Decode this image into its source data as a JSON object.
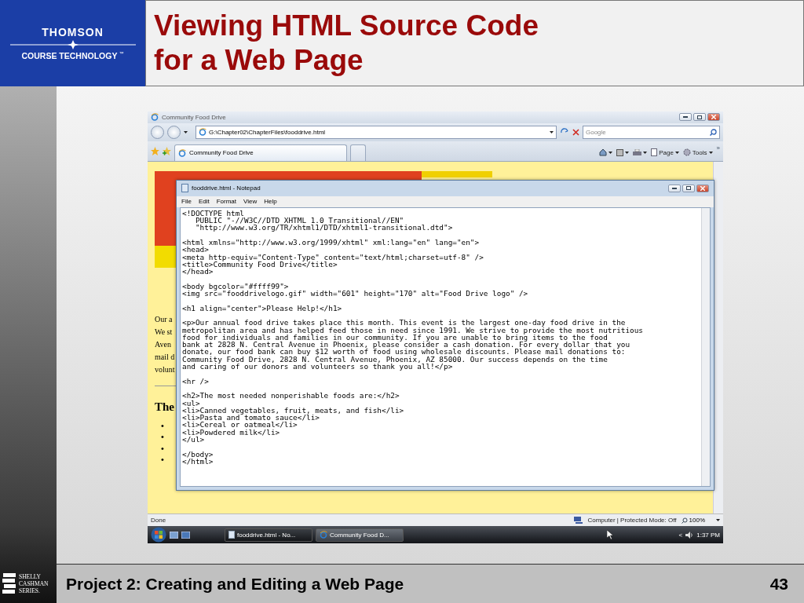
{
  "slide": {
    "logo": {
      "brand": "THOMSON",
      "sub": "COURSE TECHNOLOGY",
      "tm": "™"
    },
    "title_lines": [
      "Viewing HTML Source Code",
      "for a Web Page"
    ],
    "footer": {
      "text": "Project 2: Creating and Editing a Web Page",
      "page_number": "43",
      "series_logo_lines": [
        "SHELLY",
        "CASHMAN",
        "SERIES."
      ]
    }
  },
  "browser": {
    "title": "Community Food Drive",
    "address": "G:\\Chapter02\\ChapterFiles\\fooddrive.html",
    "search": {
      "placeholder": "Google"
    },
    "tabs": [
      {
        "label": "Community Food Drive",
        "selected": true
      }
    ],
    "commands": [
      {
        "kind": "home"
      },
      {
        "kind": "feeds"
      },
      {
        "kind": "print"
      },
      {
        "kind": "page",
        "label": "Page"
      },
      {
        "kind": "tools",
        "label": "Tools"
      }
    ],
    "chevron": "»",
    "page": {
      "text_fragments": [
        "Our a",
        "We st",
        "Aven",
        "mail d",
        "volunt"
      ],
      "heading_fragment": "The",
      "bullets": [
        "•",
        "•",
        "•",
        "•"
      ]
    },
    "status_bar": {
      "text": "Done",
      "zone": "Computer | Protected Mode: Off",
      "zoom": "100%"
    }
  },
  "notepad": {
    "title": "fooddrive.html - Notepad",
    "menu": [
      "File",
      "Edit",
      "Format",
      "View",
      "Help"
    ],
    "code_blocks": [
      [
        "<!DOCTYPE html",
        "   PUBLIC \"-//W3C//DTD XHTML 1.0 Transitional//EN\"",
        "   \"http://www.w3.org/TR/xhtml1/DTD/xhtml1-transitional.dtd\">"
      ],
      [
        "<html xmlns=\"http://www.w3.org/1999/xhtml\" xml:lang=\"en\" lang=\"en\">",
        "<head>",
        "<meta http-equiv=\"Content-Type\" content=\"text/html;charset=utf-8\" />",
        "<title>Community Food Drive</title>",
        "</head>"
      ],
      [
        "<body bgcolor=\"#ffff99\">",
        "<img src=\"fooddrivelogo.gif\" width=\"601\" height=\"170\" alt=\"Food Drive logo\" />"
      ],
      [
        "<h1 align=\"center\">Please Help!</h1>"
      ],
      [
        "<p>Our annual food drive takes place this month. This event is the largest one-day food drive in the",
        "metropolitan area and has helped feed those in need since 1991. We strive to provide the most nutritious",
        "food for individuals and families in our community. If you are unable to bring items to the food",
        "bank at 2828 N. Central Avenue in Phoenix, please consider a cash donation. For every dollar that you",
        "donate, our food bank can buy $12 worth of food using wholesale discounts. Please mail donations to:",
        "Community Food Drive, 2828 N. Central Avenue, Phoenix, AZ 85000. Our success depends on the time",
        "and caring of our donors and volunteers so thank you all!</p>"
      ],
      [
        "<hr />"
      ],
      [
        "<h2>The most needed nonperishable foods are:</h2>",
        "<ul>",
        "<li>Canned vegetables, fruit, meats, and fish</li>",
        "<li>Pasta and tomato sauce</li>",
        "<li>Cereal or oatmeal</li>",
        "<li>Powdered milk</li>",
        "</ul>"
      ],
      [
        "</body>",
        "</html>"
      ]
    ]
  },
  "taskbar": {
    "buttons": [
      {
        "label": "fooddrive.html - No...",
        "kind": "notepad",
        "selected": true
      },
      {
        "label": "Community Food D...",
        "kind": "browser",
        "selected": false
      }
    ],
    "tray_arrow": "<",
    "clock": "1:37 PM"
  }
}
